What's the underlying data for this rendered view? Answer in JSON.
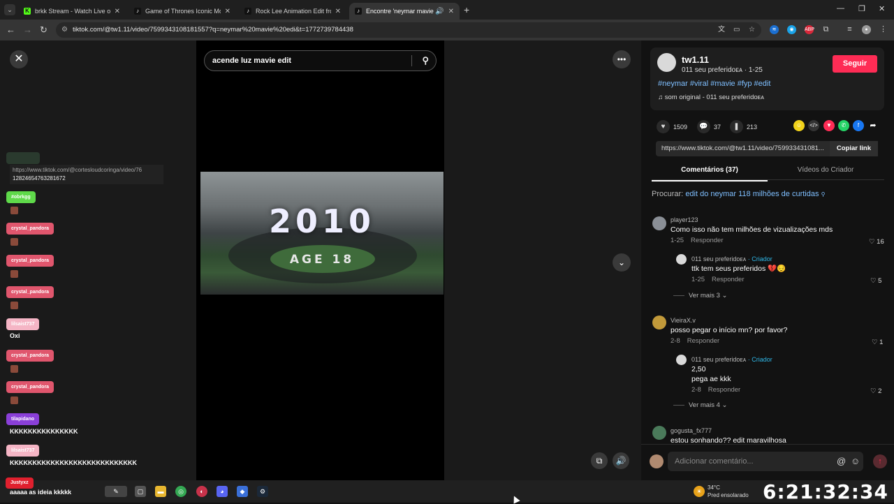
{
  "browser": {
    "tabs": [
      {
        "title": "brkk Stream - Watch Live on Ki",
        "icon": "kick-icon",
        "color": "#53fc18",
        "glyph": "K"
      },
      {
        "title": "Game of Thrones Iconic Mome",
        "icon": "tiktok-icon",
        "color": "#111111",
        "glyph": "♪"
      },
      {
        "title": "Rock Lee Animation Edit from",
        "icon": "tiktok-icon",
        "color": "#111111",
        "glyph": "♪"
      },
      {
        "title": "Encontre 'neymar mavie edi",
        "icon": "tiktok-icon",
        "color": "#111111",
        "glyph": "♪"
      }
    ],
    "url": "tiktok.com/@tw1.11/video/7599343108181557?q=neymar%20mavie%20edi&t=1772739784438"
  },
  "player": {
    "search_text": "acende luz mavie edit",
    "overlay_year": "2010",
    "overlay_age": "AGE 18"
  },
  "chat": {
    "link_line1": "https://www.tiktok.com/@cortesloudcoringa/video/76",
    "link_line2": "12824654763281672",
    "users": [
      {
        "name": "#obrkgg",
        "color": "#5fd94a"
      },
      {
        "name": "crystal_pandora",
        "color": "#e0566d"
      },
      {
        "name": "crystal_pandora",
        "color": "#e0566d"
      },
      {
        "name": "crystal_pandora",
        "color": "#e0566d"
      },
      {
        "name": "lilsaist737",
        "color": "#f5b5c5"
      },
      {
        "name": "crystal_pandora",
        "color": "#e0566d"
      },
      {
        "name": "crystal_pandora",
        "color": "#e0566d"
      },
      {
        "name": "tilapidano",
        "color": "#8a3fd8"
      },
      {
        "name": "lilsaist737",
        "color": "#f5b5c5"
      },
      {
        "name": "Justyxz",
        "color": "#e0202e"
      }
    ],
    "msg_oxi": "Oxi",
    "msg_k1": "KKKKKKKKKKKKKKK",
    "msg_k2": "KKKKKKKKKKKKKKKKKKKKKKKKKKKK",
    "msg_last": "aaaaa as ideia kkkkk"
  },
  "creator": {
    "name": "tw1.11",
    "subtitle": "011 seu preferidoᴇᴀ · 1-25",
    "follow": "Seguir",
    "tags": "#neymar #viral #mavie #fyp #edit",
    "sound": "som original - 011 seu preferidoᴇᴀ"
  },
  "stats": {
    "likes": "1509",
    "comments": "37",
    "saves": "213"
  },
  "link": {
    "url": "https://www.tiktok.com/@tw1.11/video/759933431081...",
    "copy": "Copiar link"
  },
  "tabs": {
    "comments": "Comentários (37)",
    "creator_videos": "Vídeos do Criador"
  },
  "search_suggest": {
    "label": "Procurar:",
    "query": "edit do neymar 118 milhões de curtidas"
  },
  "comments": [
    {
      "user": "player123",
      "text": "Como isso não tem milhões de vizualizações mds",
      "date": "1-25",
      "reply": "Responder",
      "likes": "16"
    },
    {
      "user": "011 seu preferidoᴇᴀ",
      "tag": "· Criador",
      "text": "ttk tem seus preferidos 💔😔",
      "date": "1-25",
      "reply": "Responder",
      "likes": "5"
    },
    {
      "more": "Ver mais 3"
    },
    {
      "user": "VieiraX.v",
      "text": "posso pegar o início mn? por favor?",
      "date": "2-8",
      "reply": "Responder",
      "likes": "1"
    },
    {
      "user": "011 seu preferidoᴇᴀ",
      "tag": "· Criador",
      "text": "2,50",
      "text2": "pega ae kkk",
      "date": "2-8",
      "reply": "Responder",
      "likes": "2"
    },
    {
      "more": "Ver mais 4"
    },
    {
      "user": "gogusta_fx777",
      "text": "estou sonhando?? edit maravilhosa"
    }
  ],
  "comment_input": {
    "placeholder": "Adicionar comentário..."
  },
  "taskbar": {
    "temp": "34°C",
    "weather": "Pred ensolarado",
    "clock": "6:21:32:34"
  }
}
